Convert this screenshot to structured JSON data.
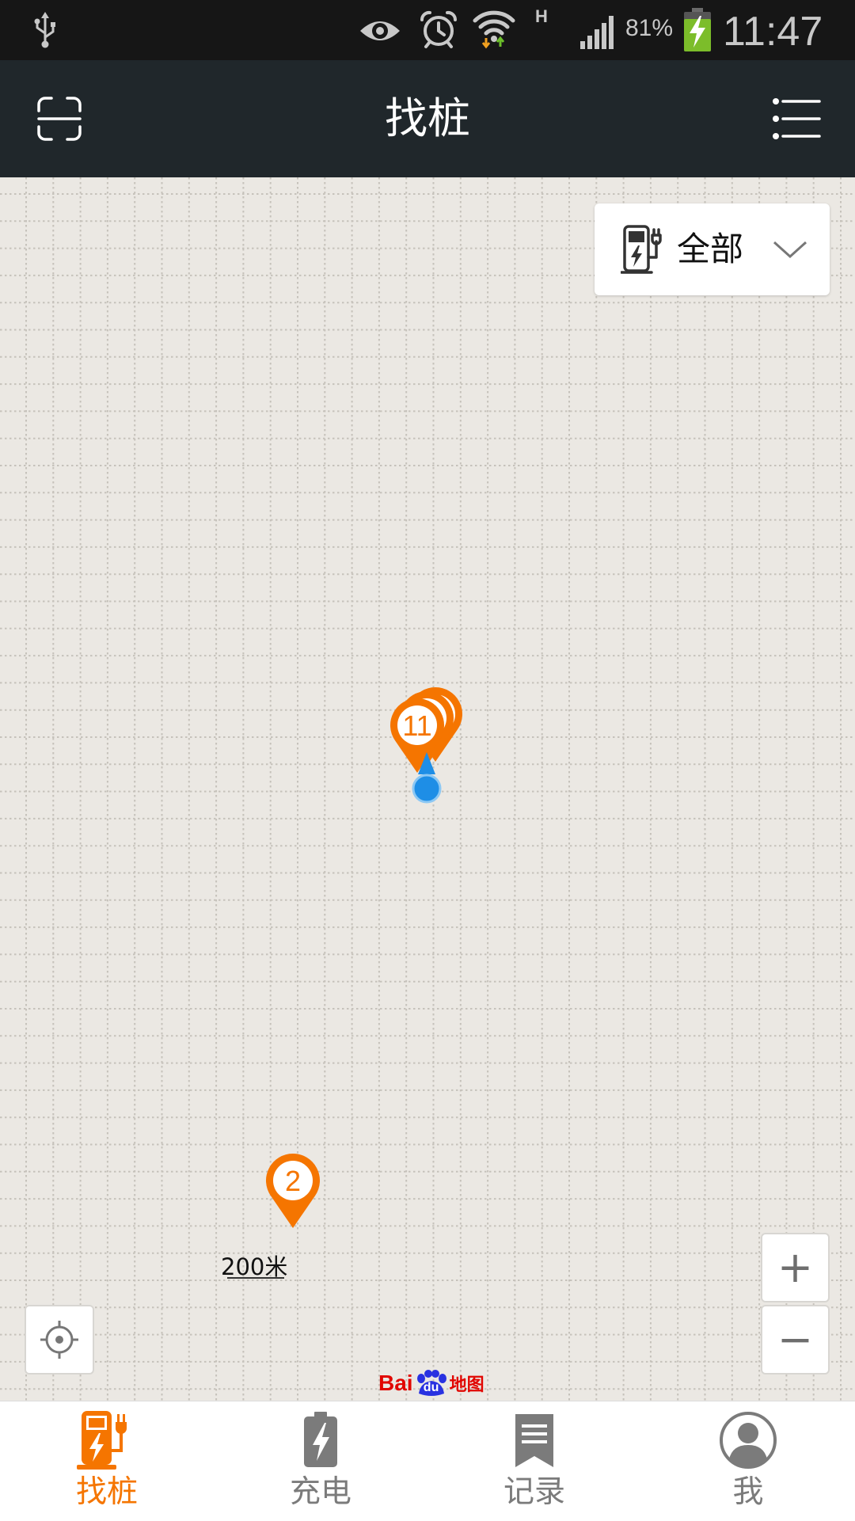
{
  "status_bar": {
    "network_type": "H",
    "battery": "81%",
    "time": "11:47",
    "icons": [
      "usb-icon",
      "eye-icon",
      "alarm-icon",
      "wifi-icon",
      "signal-icon",
      "battery-charging-icon"
    ]
  },
  "header": {
    "title": "找桩",
    "left_icon": "scan-icon",
    "right_icon": "menu-icon"
  },
  "filter": {
    "selected": "全部",
    "icon": "charging-station-icon",
    "dropdown_icon": "chevron-down-icon"
  },
  "map": {
    "cluster_markers": [
      {
        "count": "11"
      },
      {
        "count": "2"
      }
    ],
    "scale": "200米",
    "zoom_in": "+",
    "zoom_out": "−",
    "locate_icon": "locate-icon",
    "logo": {
      "bai": "Bai",
      "du": "du",
      "ditu": "地图"
    }
  },
  "tabs": [
    {
      "label": "找桩",
      "icon": "charging-station-icon",
      "active": true
    },
    {
      "label": "充电",
      "icon": "battery-charge-icon",
      "active": false
    },
    {
      "label": "记录",
      "icon": "record-icon",
      "active": false
    },
    {
      "label": "我",
      "icon": "user-icon",
      "active": false
    }
  ],
  "colors": {
    "accent": "#f57500",
    "header_bg": "#20272b",
    "status_bg": "#161616",
    "map_bg": "#ebe8e3",
    "location_blue": "#1e8ee6",
    "inactive": "#7b7b7b"
  }
}
